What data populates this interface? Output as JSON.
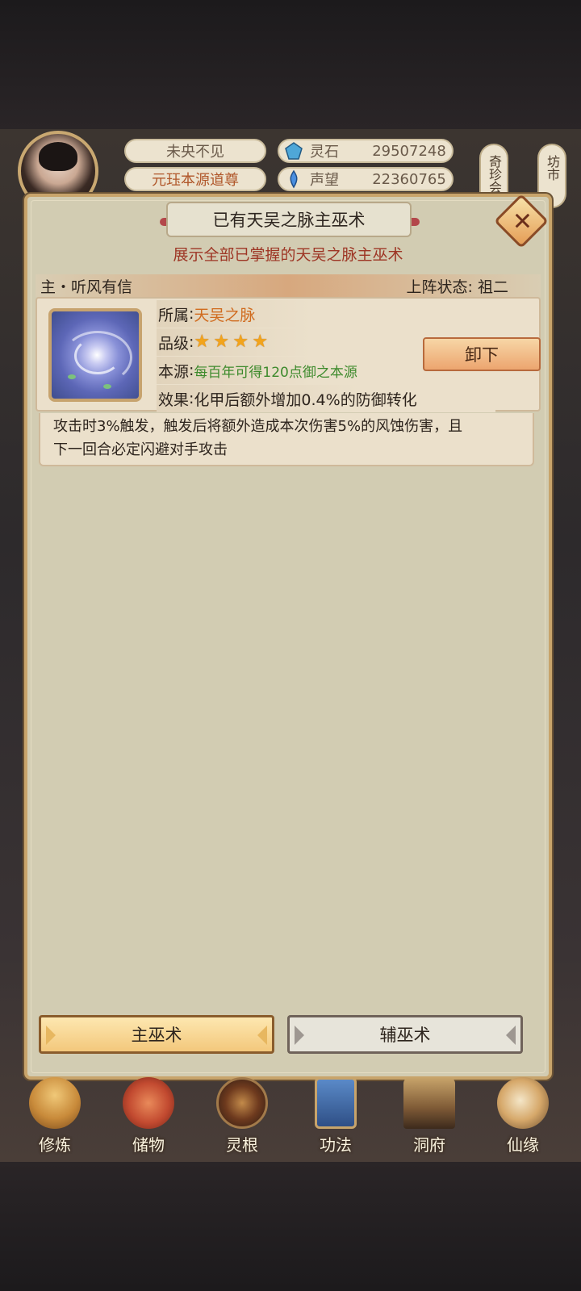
{
  "hud": {
    "player_name": "未央不见",
    "player_title": "元珏本源道尊",
    "resources": [
      {
        "name": "灵石",
        "value": "29507248",
        "icon": "spirit-stone-icon",
        "color": "#4fa7d8"
      },
      {
        "name": "声望",
        "value": "22360765",
        "icon": "prestige-icon",
        "color": "#4a8fe0"
      }
    ],
    "side_tabs": [
      "奇珍会",
      "坊市"
    ]
  },
  "dialog": {
    "title": "已有天吴之脉主巫术",
    "subtitle": "展示全部已掌握的天吴之脉主巫术",
    "skill": {
      "name": "主・听风有信",
      "status_label": "上阵状态",
      "status_value": "祖二",
      "attribute_label": "所属",
      "attribute_value": "天吴之脉",
      "grade_label": "品级",
      "grade_stars": 4,
      "source_label": "本源",
      "source_value": "每百年可得120点御之本源",
      "effect_label": "效果",
      "effect_value": "化甲后额外增加0.4%的防御转化",
      "description_line1": "攻击时3%触发，触发后将额外造成本次伤害5%的风蚀伤害，且",
      "description_line2": "下一回合必定闪避对手攻击",
      "unequip_label": "卸下"
    },
    "tabs": {
      "main": "主巫术",
      "aux": "辅巫术"
    }
  },
  "nav": [
    {
      "label": "修炼",
      "icon": "cultivate-icon"
    },
    {
      "label": "储物",
      "icon": "storage-bag-icon"
    },
    {
      "label": "灵根",
      "icon": "spirit-root-icon"
    },
    {
      "label": "功法",
      "icon": "technique-book-icon"
    },
    {
      "label": "洞府",
      "icon": "cave-dwelling-icon"
    },
    {
      "label": "仙缘",
      "icon": "immortal-fate-icon"
    }
  ],
  "colors": {
    "accent_orange": "#d06b1e",
    "source_green": "#3d8a2c",
    "subtitle_red": "#9d3524",
    "star": "#f2a41c"
  }
}
